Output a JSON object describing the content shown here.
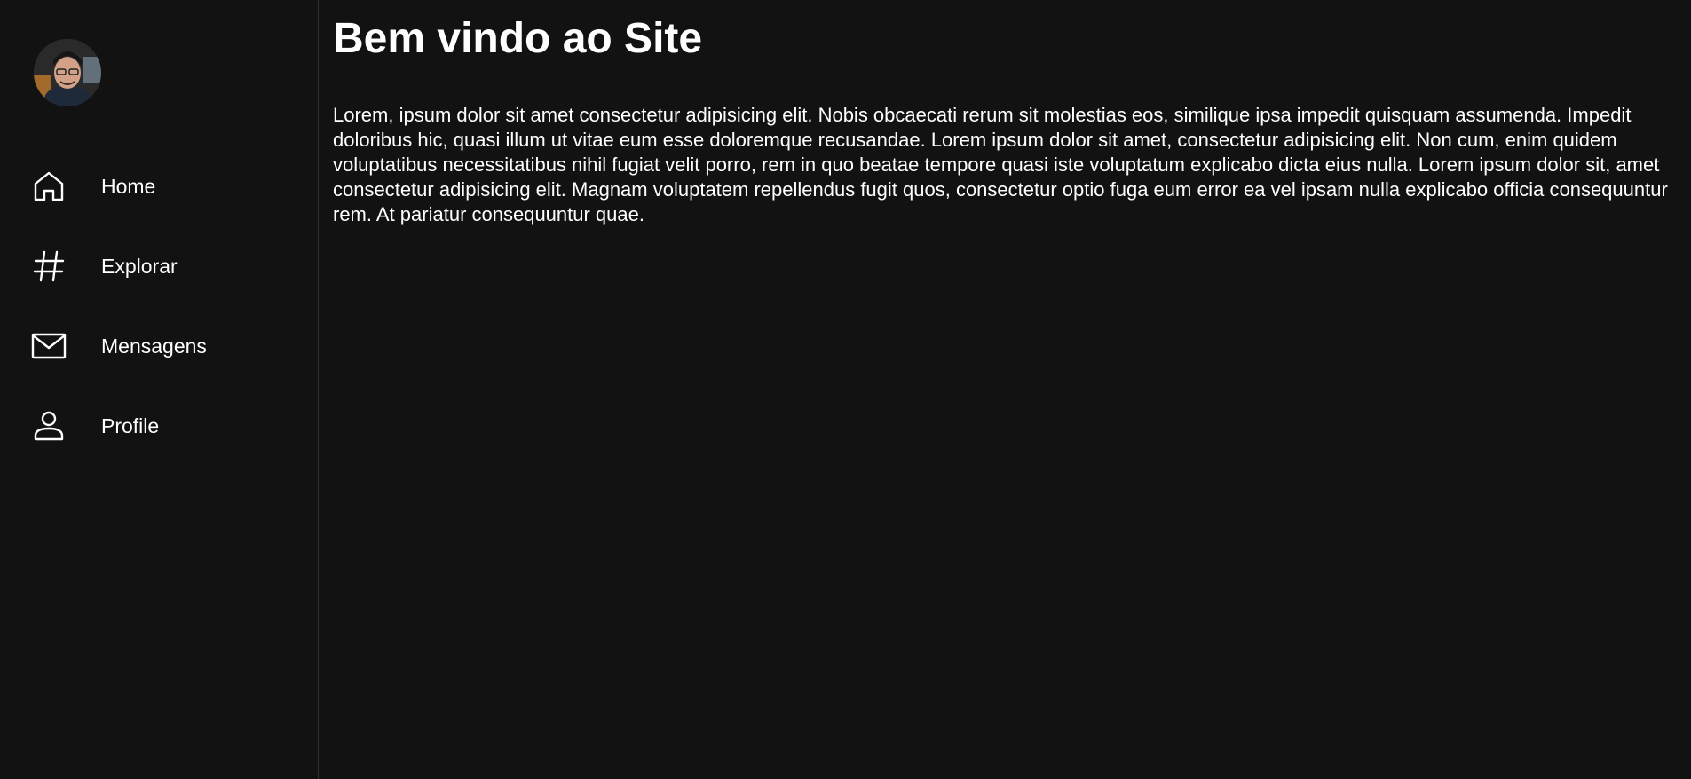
{
  "sidebar": {
    "avatar_icon": "user-photo",
    "items": [
      {
        "label": "Home",
        "icon": "home-icon"
      },
      {
        "label": "Explorar",
        "icon": "hashtag-icon"
      },
      {
        "label": "Mensagens",
        "icon": "mail-icon"
      },
      {
        "label": "Profile",
        "icon": "person-icon"
      }
    ]
  },
  "main": {
    "title": "Bem vindo ao Site",
    "body": "Lorem, ipsum dolor sit amet consectetur adipisicing elit. Nobis obcaecati rerum sit molestias eos, similique ipsa impedit quisquam assumenda. Impedit doloribus hic, quasi illum ut vitae eum esse doloremque recusandae. Lorem ipsum dolor sit amet, consectetur adipisicing elit. Non cum, enim quidem voluptatibus necessitatibus nihil fugiat velit porro, rem in quo beatae tempore quasi iste voluptatum explicabo dicta eius nulla. Lorem ipsum dolor sit, amet consectetur adipisicing elit. Magnam voluptatem repellendus fugit quos, consectetur optio fuga eum error ea vel ipsam nulla explicabo officia consequuntur rem. At pariatur consequuntur quae."
  },
  "colors": {
    "background": "#121212",
    "text": "#ffffff",
    "divider": "#2e2e2e"
  }
}
